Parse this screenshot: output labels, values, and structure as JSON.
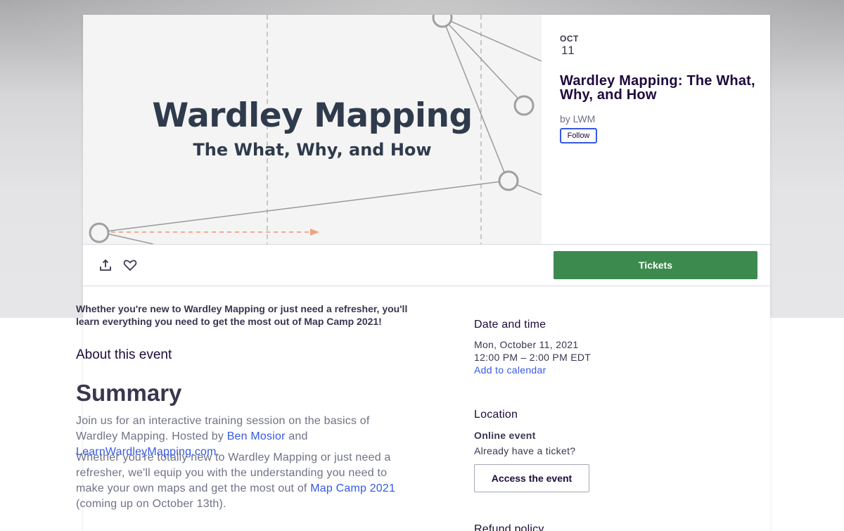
{
  "hero": {
    "title": "Wardley Mapping",
    "subtitle": "The What, Why, and How"
  },
  "event": {
    "month": "OCT",
    "day": "11",
    "title": "Wardley Mapping: The What, Why, and How",
    "organizer": "by LWM",
    "follow_label": "Follow"
  },
  "actions": {
    "share_icon": "share-icon",
    "like_icon": "heart-icon",
    "tickets_label": "Tickets"
  },
  "content": {
    "intro": "Whether you're new to Wardley Mapping or just need a refresher, you'll learn everything you need to get the most out of Map Camp 2021!",
    "about_heading": "About this event",
    "summary_heading": "Summary",
    "p1_before": "Join us for an interactive training session on the basics of Wardley Mapping. Hosted by ",
    "p1_link1": "Ben Mosior",
    "p1_mid": " and ",
    "p1_link2": "LearnWardleyMapping.com",
    "p1_after": ".",
    "p2_before": "Whether you're totally new to Wardley Mapping or just need a refresher, we'll equip you with the understanding you need to make your own maps and get the most out of ",
    "p2_link": "Map Camp 2021",
    "p2_after": " (coming up on October 13th)."
  },
  "sidebar": {
    "date_heading": "Date and time",
    "date_line": "Mon, October 11, 2021",
    "time_line": "12:00 PM – 2:00 PM EDT",
    "calendar_link": "Add to calendar",
    "location_heading": "Location",
    "location_type": "Online event",
    "ticket_prompt": "Already have a ticket?",
    "access_label": "Access the event",
    "refund_heading": "Refund policy"
  },
  "colors": {
    "tickets_green": "#3d8a4f",
    "link_blue": "#3659e3",
    "arrow_orange": "#f0a27f"
  }
}
